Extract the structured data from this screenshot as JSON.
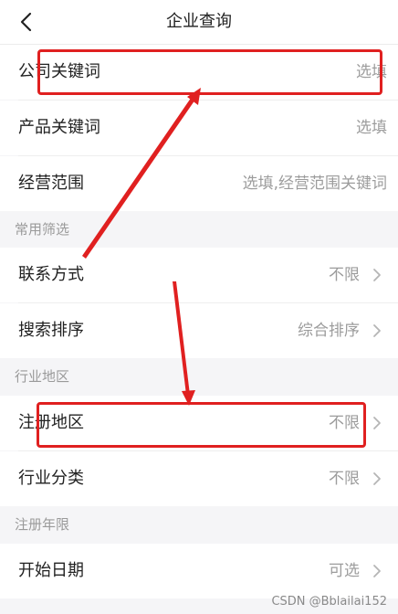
{
  "header": {
    "title": "企业查询"
  },
  "rows": {
    "company_keyword": {
      "label": "公司关键词",
      "value": "选填"
    },
    "product_keyword": {
      "label": "产品关键词",
      "value": "选填"
    },
    "business_scope": {
      "label": "经营范围",
      "value": "选填,经营范围关键词"
    },
    "contact_method": {
      "label": "联系方式",
      "value": "不限"
    },
    "search_sort": {
      "label": "搜索排序",
      "value": "综合排序"
    },
    "registered_region": {
      "label": "注册地区",
      "value": "不限"
    },
    "industry_category": {
      "label": "行业分类",
      "value": "不限"
    },
    "start_date": {
      "label": "开始日期",
      "value": "可选"
    }
  },
  "sections": {
    "common_filters": "常用筛选",
    "industry_region": "行业地区",
    "registration_years": "注册年限"
  },
  "annotation_color": "#e02020",
  "watermark": "CSDN @Bblailai152"
}
